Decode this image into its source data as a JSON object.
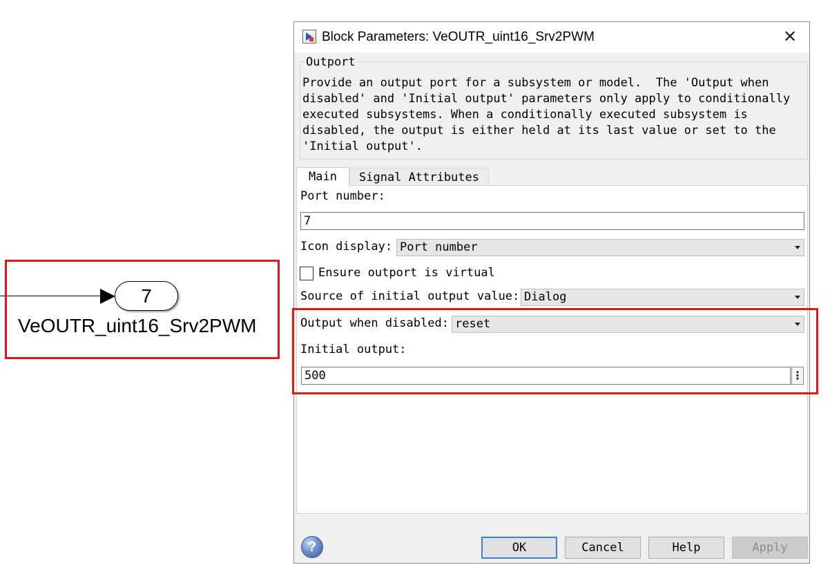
{
  "canvas": {
    "outport_number": "7",
    "outport_name": "VeOUTR_uint16_Srv2PWM"
  },
  "dialog": {
    "title": "Block Parameters: VeOUTR_uint16_Srv2PWM",
    "close_glyph": "✕",
    "group_label": "Outport",
    "description": "Provide an output port for a subsystem or model.  The 'Output when\ndisabled' and 'Initial output' parameters only apply to conditionally\nexecuted subsystems. When a conditionally executed subsystem is\ndisabled, the output is either held at its last value or set to the\n'Initial output'.",
    "tabs": [
      {
        "label": "Main",
        "active": true
      },
      {
        "label": "Signal Attributes",
        "active": false
      }
    ],
    "main": {
      "port_number_label": "Port number:",
      "port_number_value": "7",
      "icon_display_label": "Icon display:",
      "icon_display_value": "Port number",
      "ensure_virtual_label": "Ensure outport is virtual",
      "ensure_virtual_checked": false,
      "source_initial_label": "Source of initial output value:",
      "source_initial_value": "Dialog",
      "output_disabled_label": "Output when disabled:",
      "output_disabled_value": "reset",
      "initial_output_label": "Initial output:",
      "initial_output_value": "500",
      "more_glyph": "⋮"
    },
    "buttons": {
      "help_icon": "?",
      "ok": "OK",
      "cancel": "Cancel",
      "help": "Help",
      "apply": "Apply"
    }
  },
  "colors": {
    "highlight": "#e0161c",
    "ok_focus": "#3c7fd6"
  },
  "icons": [
    "simulink-block-icon",
    "close-icon",
    "dropdown-arrow-icon",
    "more-options-icon",
    "help-icon"
  ]
}
